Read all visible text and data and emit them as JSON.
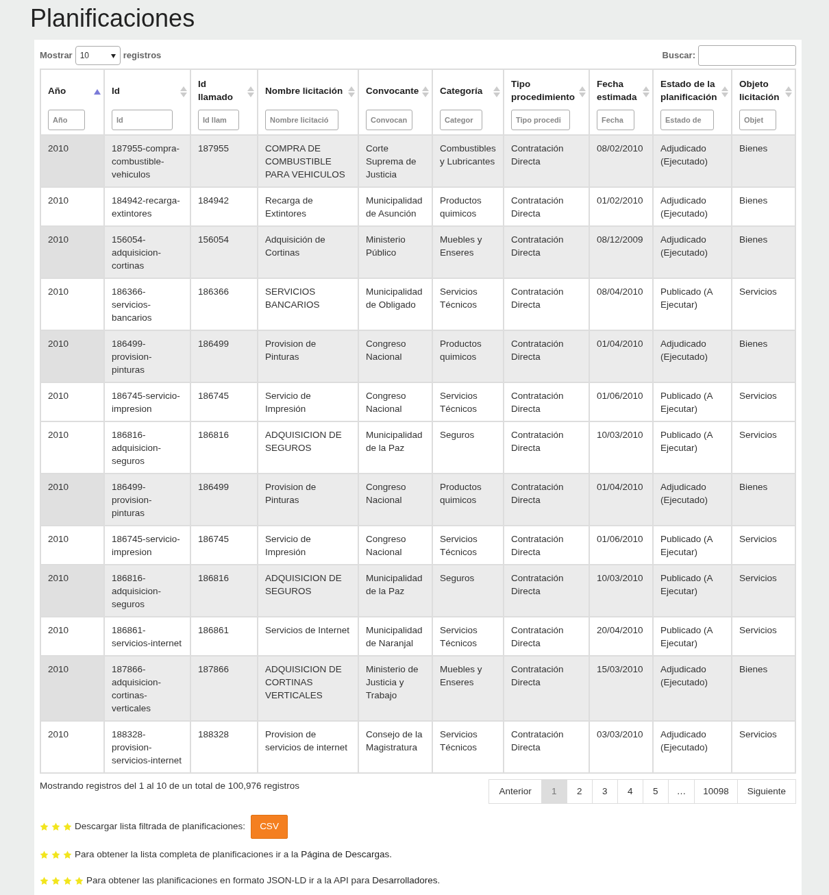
{
  "title": "Planificaciones",
  "length_menu": {
    "before": "Mostrar",
    "value": "10",
    "after": "registros"
  },
  "search": {
    "label": "Buscar:"
  },
  "columns": [
    {
      "label": "Año",
      "sorted": true,
      "placeholder": "Año"
    },
    {
      "label": "Id",
      "sorted": false,
      "placeholder": "Id"
    },
    {
      "label": "Id llamado",
      "sorted": false,
      "placeholder": "Id llam"
    },
    {
      "label": "Nombre licitación",
      "sorted": false,
      "placeholder": "Nombre licitació"
    },
    {
      "label": "Convocante",
      "sorted": false,
      "placeholder": "Convocan"
    },
    {
      "label": "Categoría",
      "sorted": false,
      "placeholder": "Categor"
    },
    {
      "label": "Tipo procedimiento",
      "sorted": false,
      "placeholder": "Tipo procedi"
    },
    {
      "label": "Fecha estimada",
      "sorted": false,
      "placeholder": "Fecha"
    },
    {
      "label": "Estado de la planificación",
      "sorted": false,
      "placeholder": "Estado de"
    },
    {
      "label": "Objeto licitación",
      "sorted": false,
      "placeholder": "Objet"
    }
  ],
  "rows": [
    {
      "shaded": true,
      "cells": [
        "2010",
        "187955-compra-combustible-vehiculos",
        "187955",
        "COMPRA DE COMBUSTIBLE PARA VEHICULOS",
        "Corte Suprema de Justicia",
        "Combustibles y Lubricantes",
        "Contratación Directa",
        "08/02/2010",
        "Adjudicado (Ejecutado)",
        "Bienes"
      ]
    },
    {
      "shaded": false,
      "cells": [
        "2010",
        "184942-recarga-extintores",
        "184942",
        "Recarga de Extintores",
        "Municipalidad de Asunción",
        "Productos quimicos",
        "Contratación Directa",
        "01/02/2010",
        "Adjudicado (Ejecutado)",
        "Bienes"
      ]
    },
    {
      "shaded": true,
      "cells": [
        "2010",
        "156054-adquisicion-cortinas",
        "156054",
        "Adquisición de Cortinas",
        "Ministerio Público",
        "Muebles y Enseres",
        "Contratación Directa",
        "08/12/2009",
        "Adjudicado (Ejecutado)",
        "Bienes"
      ]
    },
    {
      "shaded": false,
      "cells": [
        "2010",
        "186366-servicios-bancarios",
        "186366",
        "SERVICIOS BANCARIOS",
        "Municipalidad de Obligado",
        "Servicios Técnicos",
        "Contratación Directa",
        "08/04/2010",
        "Publicado (A Ejecutar)",
        "Servicios"
      ]
    },
    {
      "shaded": true,
      "cells": [
        "2010",
        "186499-provision-pinturas",
        "186499",
        "Provision de Pinturas",
        "Congreso Nacional",
        "Productos quimicos",
        "Contratación Directa",
        "01/04/2010",
        "Adjudicado (Ejecutado)",
        "Bienes"
      ]
    },
    {
      "shaded": false,
      "cells": [
        "2010",
        "186745-servicio-impresion",
        "186745",
        "Servicio de Impresión",
        "Congreso Nacional",
        "Servicios Técnicos",
        "Contratación Directa",
        "01/06/2010",
        "Publicado (A Ejecutar)",
        "Servicios"
      ]
    },
    {
      "shaded": false,
      "cells": [
        "2010",
        "186816-adquisicion-seguros",
        "186816",
        "ADQUISICION DE SEGUROS",
        "Municipalidad de la Paz",
        "Seguros",
        "Contratación Directa",
        "10/03/2010",
        "Publicado (A Ejecutar)",
        "Servicios"
      ]
    },
    {
      "shaded": true,
      "cells": [
        "2010",
        "186499-provision-pinturas",
        "186499",
        "Provision de Pinturas",
        "Congreso Nacional",
        "Productos quimicos",
        "Contratación Directa",
        "01/04/2010",
        "Adjudicado (Ejecutado)",
        "Bienes"
      ]
    },
    {
      "shaded": false,
      "cells": [
        "2010",
        "186745-servicio-impresion",
        "186745",
        "Servicio de Impresión",
        "Congreso Nacional",
        "Servicios Técnicos",
        "Contratación Directa",
        "01/06/2010",
        "Publicado (A Ejecutar)",
        "Servicios"
      ]
    },
    {
      "shaded": true,
      "cells": [
        "2010",
        "186816-adquisicion-seguros",
        "186816",
        "ADQUISICION DE SEGUROS",
        "Municipalidad de la Paz",
        "Seguros",
        "Contratación Directa",
        "10/03/2010",
        "Publicado (A Ejecutar)",
        "Servicios"
      ]
    },
    {
      "shaded": false,
      "cells": [
        "2010",
        "186861-servicios-internet",
        "186861",
        "Servicios de Internet",
        "Municipalidad de Naranjal",
        "Servicios Técnicos",
        "Contratación Directa",
        "20/04/2010",
        "Publicado (A Ejecutar)",
        "Servicios"
      ]
    },
    {
      "shaded": true,
      "cells": [
        "2010",
        "187866-adquisicion-cortinas-verticales",
        "187866",
        "ADQUISICION DE CORTINAS VERTICALES",
        "Ministerio de Justicia y Trabajo",
        "Muebles y Enseres",
        "Contratación Directa",
        "15/03/2010",
        "Adjudicado (Ejecutado)",
        "Bienes"
      ]
    },
    {
      "shaded": false,
      "cells": [
        "2010",
        "188328-provision-servicios-internet",
        "188328",
        "Provision de servicios de internet",
        "Consejo de la Magistratura",
        "Servicios Técnicos",
        "Contratación Directa",
        "03/03/2010",
        "Adjudicado (Ejecutado)",
        "Servicios"
      ]
    }
  ],
  "info": "Mostrando registros del 1 al 10 de un total de 100,976 registros",
  "pagination": [
    {
      "label": "Anterior",
      "selected": false
    },
    {
      "label": "1",
      "selected": true
    },
    {
      "label": "2",
      "selected": false
    },
    {
      "label": "3",
      "selected": false
    },
    {
      "label": "4",
      "selected": false
    },
    {
      "label": "5",
      "selected": false
    },
    {
      "label": "…",
      "selected": false
    },
    {
      "label": "10098",
      "selected": false
    },
    {
      "label": "Siguiente",
      "selected": false
    }
  ],
  "notes": [
    {
      "stars": 3,
      "text": "Descargar lista filtrada de planificaciones:",
      "button": "CSV"
    },
    {
      "stars": 3,
      "text": "Para obtener la lista completa de planificaciones ir a la",
      "link": "Página de Descargas",
      "after": "."
    },
    {
      "stars": 4,
      "text": "Para obtener las planificaciones en formato JSON-LD ir a la API para",
      "link": "Desarrolladores",
      "after": "."
    }
  ]
}
